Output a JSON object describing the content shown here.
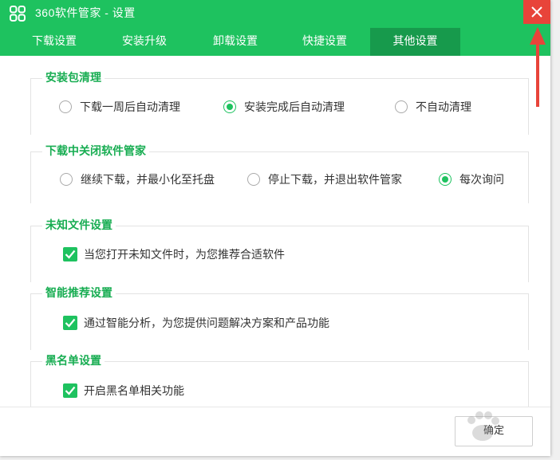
{
  "window": {
    "title": "360软件管家 - 设置",
    "accent": "#1ec25f",
    "close_color": "#e8443a"
  },
  "tabs": [
    {
      "label": "下载设置"
    },
    {
      "label": "安装升级"
    },
    {
      "label": "卸载设置"
    },
    {
      "label": "快捷设置"
    },
    {
      "label": "其他设置",
      "active": true
    }
  ],
  "groups": {
    "cleanup": {
      "title": "安装包清理",
      "options": [
        "下载一周后自动清理",
        "安装完成后自动清理",
        "不自动清理"
      ],
      "selected": "安装完成后自动清理"
    },
    "close_during_download": {
      "title": "下载中关闭软件管家",
      "options": [
        "继续下载，并最小化至托盘",
        "停止下载，并退出软件管家",
        "每次询问"
      ],
      "selected": "每次询问"
    },
    "unknown_files": {
      "title": "未知文件设置",
      "checkbox": {
        "label": "当您打开未知文件时，为您推荐合适软件",
        "checked": true
      }
    },
    "smart_recommend": {
      "title": "智能推荐设置",
      "checkbox": {
        "label": "通过智能分析，为您提供问题解决方案和产品功能",
        "checked": true
      }
    },
    "blacklist": {
      "title": "黑名单设置",
      "checkbox": {
        "label": "开启黑名单相关功能",
        "checked": true
      }
    }
  },
  "footer": {
    "ok_label": "确定"
  },
  "overlay": {
    "annotation_arrow_color": "#e8443a",
    "watermark_icon": "paw-watermark"
  }
}
